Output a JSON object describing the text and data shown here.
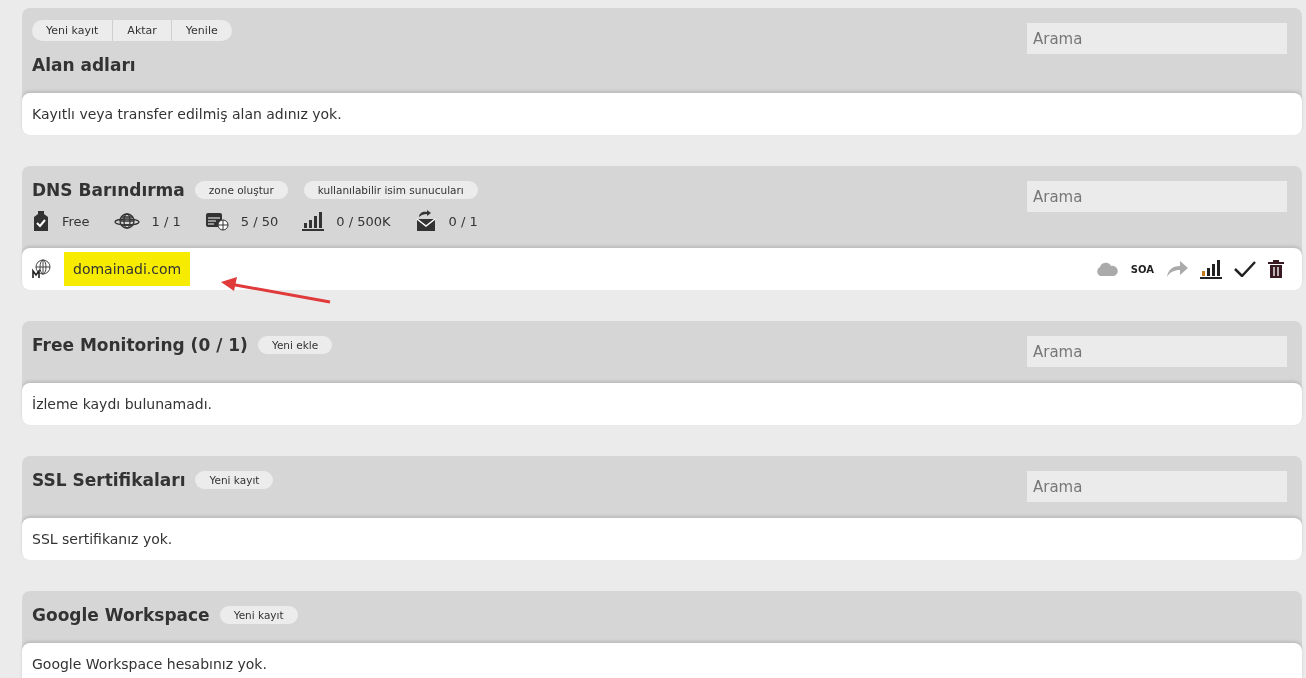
{
  "sections": [
    {
      "title": "Alan adları",
      "toolbar": [
        "Yeni kayıt",
        "Aktar",
        "Yenile"
      ],
      "search": {
        "placeholder": "Arama"
      },
      "message": "Kayıtlı veya transfer edilmiş alan adınız yok."
    },
    {
      "title": "DNS Barındırma",
      "buttons": [
        "zone oluştur",
        "kullanılabilir isim sunucuları"
      ],
      "search": {
        "placeholder": "Arama"
      },
      "stats": [
        {
          "kind": "plan",
          "value": "Free"
        },
        {
          "kind": "zones",
          "value": "1 / 1"
        },
        {
          "kind": "records",
          "value": "5 / 50"
        },
        {
          "kind": "queries",
          "value": "0 / 500K"
        },
        {
          "kind": "mail",
          "value": "0 / 1"
        }
      ],
      "rows": [
        {
          "name": "domainadi.com",
          "highlighted": true,
          "annotated": true,
          "actions": [
            {
              "kind": "cloud",
              "disabled": true
            },
            {
              "kind": "soa",
              "label": "SOA",
              "disabled": false
            },
            {
              "kind": "forward",
              "disabled": true
            },
            {
              "kind": "chart",
              "disabled": false
            },
            {
              "kind": "check",
              "disabled": false
            },
            {
              "kind": "trash",
              "disabled": false
            }
          ]
        }
      ]
    },
    {
      "title": "Free Monitoring (0 / 1)",
      "buttons": [
        "Yeni ekle"
      ],
      "search": {
        "placeholder": "Arama"
      },
      "message": "İzleme kaydı bulunamadı."
    },
    {
      "title": "SSL Sertifikaları",
      "buttons": [
        "Yeni kayıt"
      ],
      "search": {
        "placeholder": "Arama"
      },
      "message": "SSL sertifikanız yok."
    },
    {
      "title": "Google Workspace",
      "buttons": [
        "Yeni kayıt"
      ],
      "message": "Google Workspace hesabınız yok."
    }
  ]
}
